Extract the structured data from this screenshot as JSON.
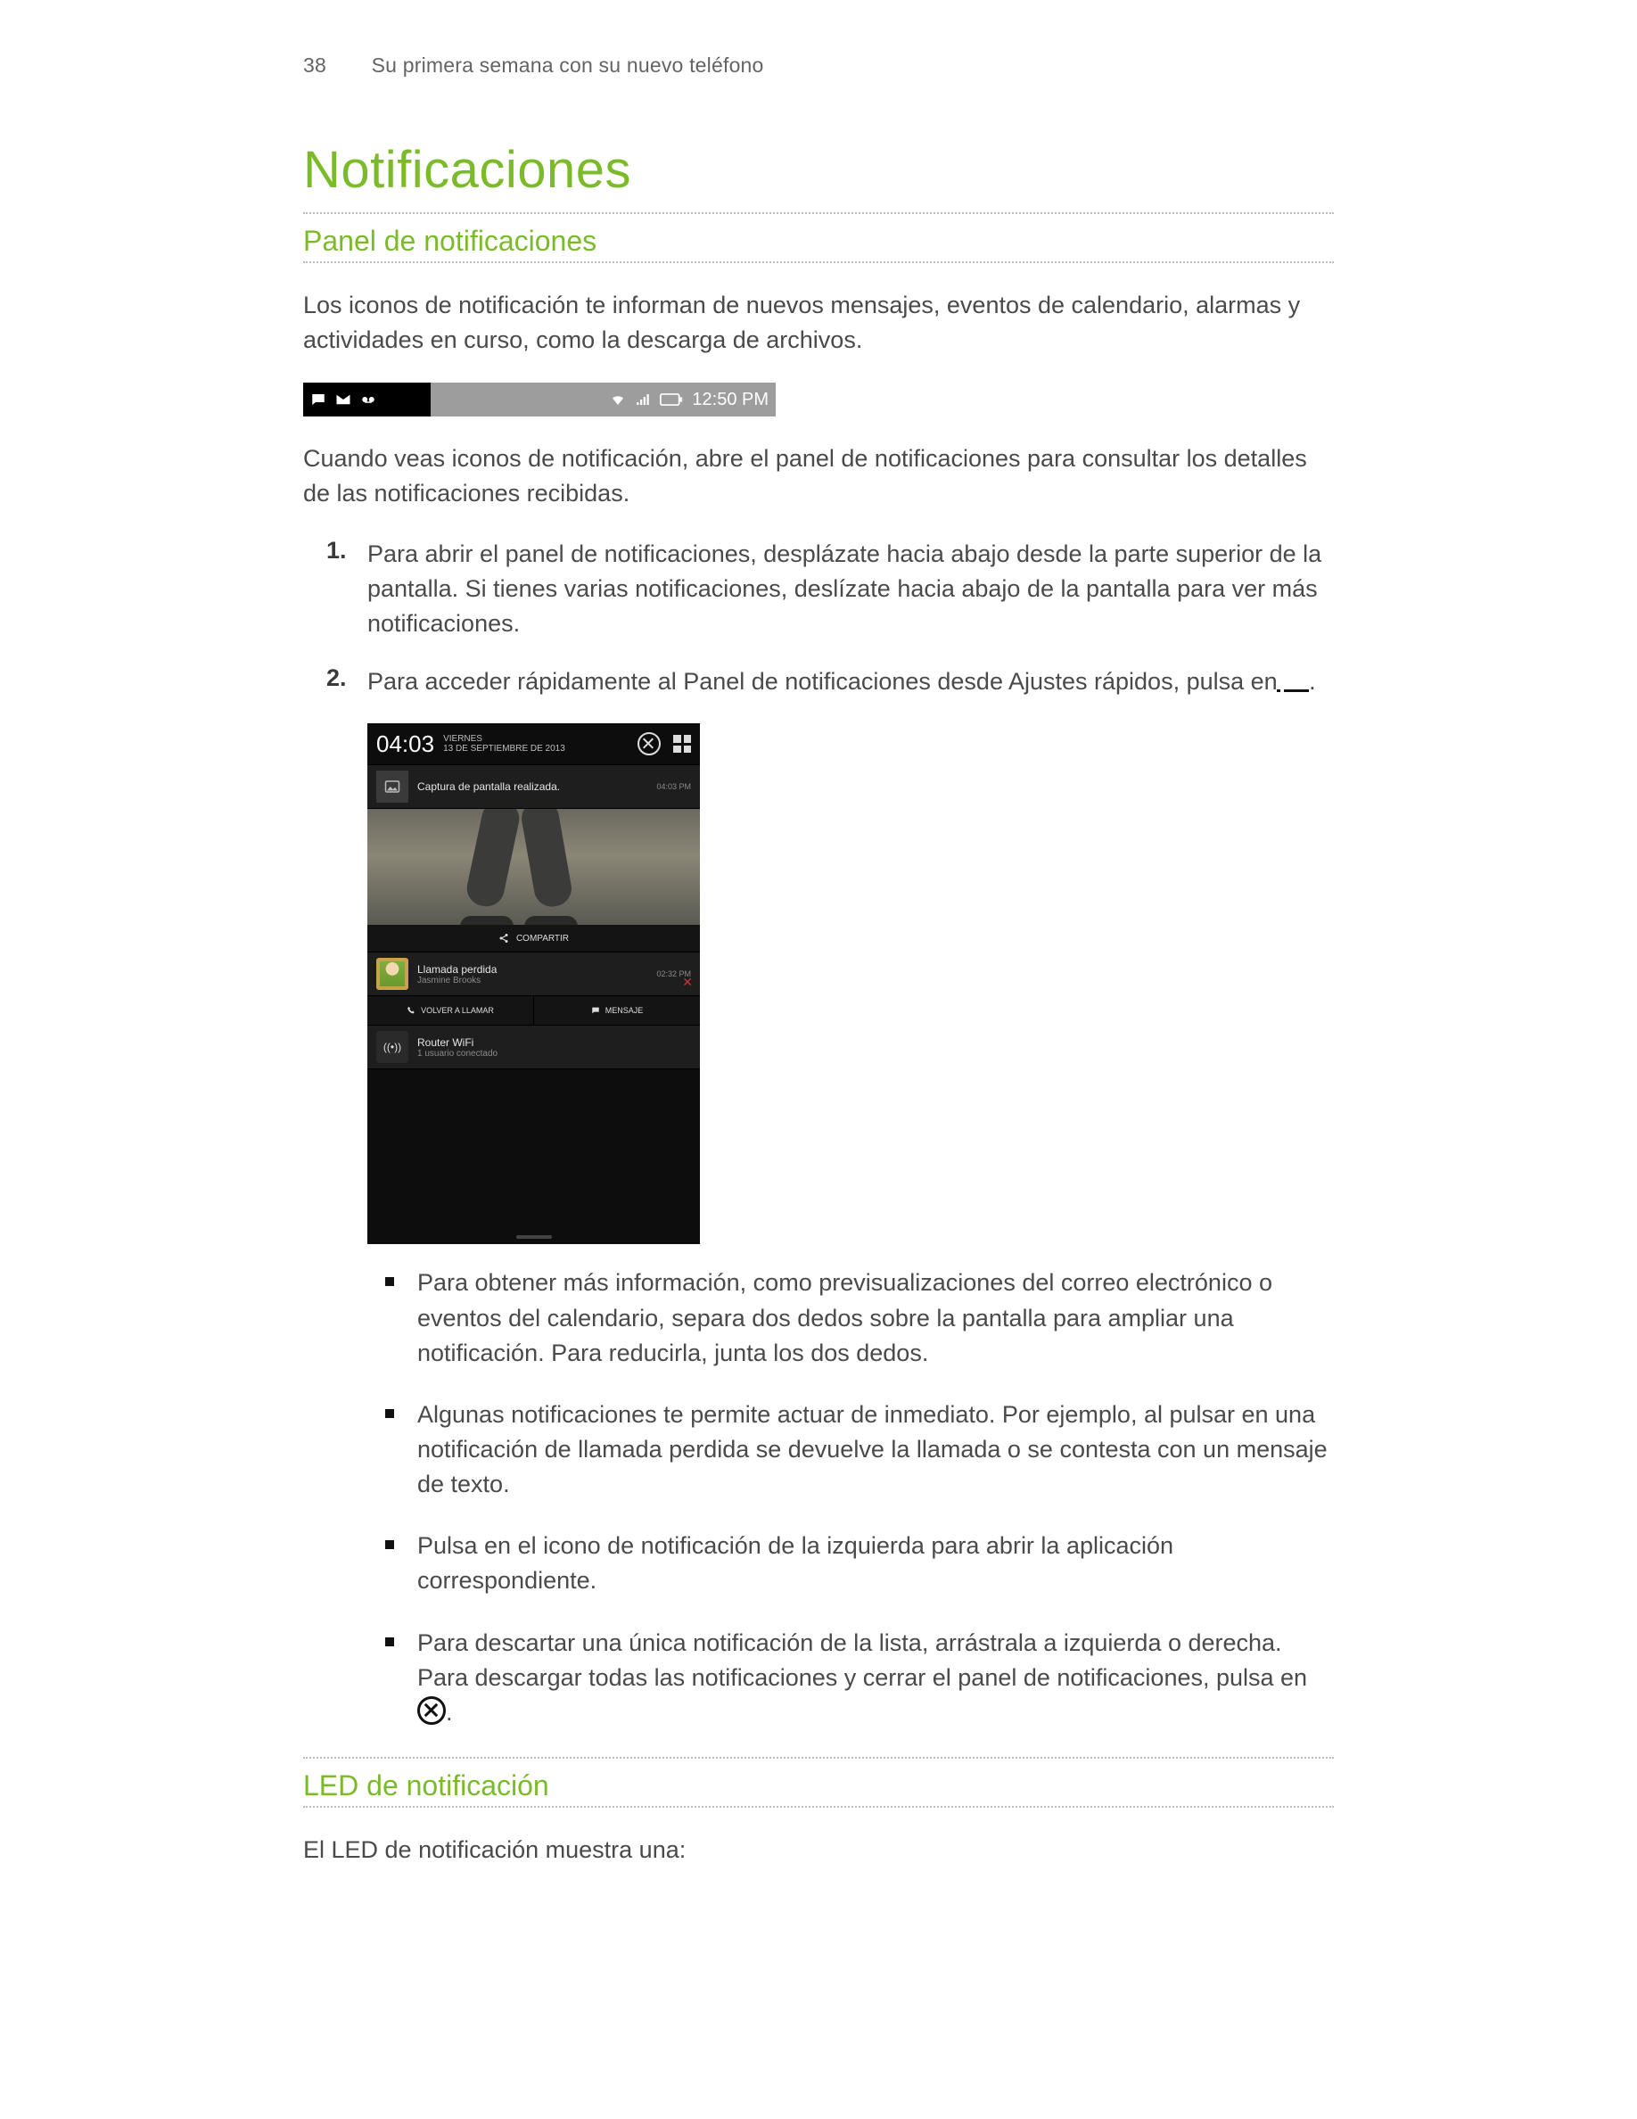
{
  "header": {
    "page_number": "38",
    "chapter": "Su primera semana con su nuevo teléfono"
  },
  "title": "Notificaciones",
  "section1": {
    "heading": "Panel de notificaciones",
    "p1": "Los iconos de notificación te informan de nuevos mensajes, eventos de calendario, alarmas y actividades en curso, como la descarga de archivos.",
    "statusbar_time": "12:50 PM",
    "p2": "Cuando veas iconos de notificación, abre el panel de notificaciones para consultar los detalles de las notificaciones recibidas.",
    "steps": [
      "Para abrir el panel de notificaciones, desplázate hacia abajo desde la parte superior de la pantalla. Si tienes varias notificaciones, deslízate hacia abajo de la pantalla para ver más notificaciones.",
      "Para acceder rápidamente al Panel de notificaciones desde Ajustes rápidos, pulsa en"
    ],
    "step2_tail": ".",
    "bullets": [
      "Para obtener más información, como previsualizaciones del correo electrónico o eventos del calendario, separa dos dedos sobre la pantalla para ampliar una notificación. Para reducirla, junta los dos dedos.",
      "Algunas notificaciones te permite actuar de inmediato. Por ejemplo, al pulsar en una notificación de llamada perdida se devuelve la llamada o se contesta con un mensaje de texto.",
      "Pulsa en el icono de notificación de la izquierda para abrir la aplicación correspondiente."
    ],
    "bullet4_lead": "Para descartar una única notificación de la lista, arrástrala a izquierda o derecha. Para descargar todas las notificaciones y cerrar el panel de notificaciones, pulsa en",
    "bullet4_tail": "."
  },
  "phone": {
    "clock": "04:03",
    "day": "VIERNES",
    "date": "13 DE SEPTIEMBRE DE 2013",
    "shot_title": "Captura de pantalla realizada.",
    "shot_time": "04:03 PM",
    "share": "COMPARTIR",
    "call_title": "Llamada perdida",
    "call_name": "Jasmine Brooks",
    "call_time": "02:32 PM",
    "action_back": "VOLVER A LLAMAR",
    "action_msg": "MENSAJE",
    "wifi_title": "Router WiFi",
    "wifi_sub": "1 usuario conectado"
  },
  "section2": {
    "heading": "LED de notificación",
    "p1": "El LED de notificación muestra una:"
  }
}
